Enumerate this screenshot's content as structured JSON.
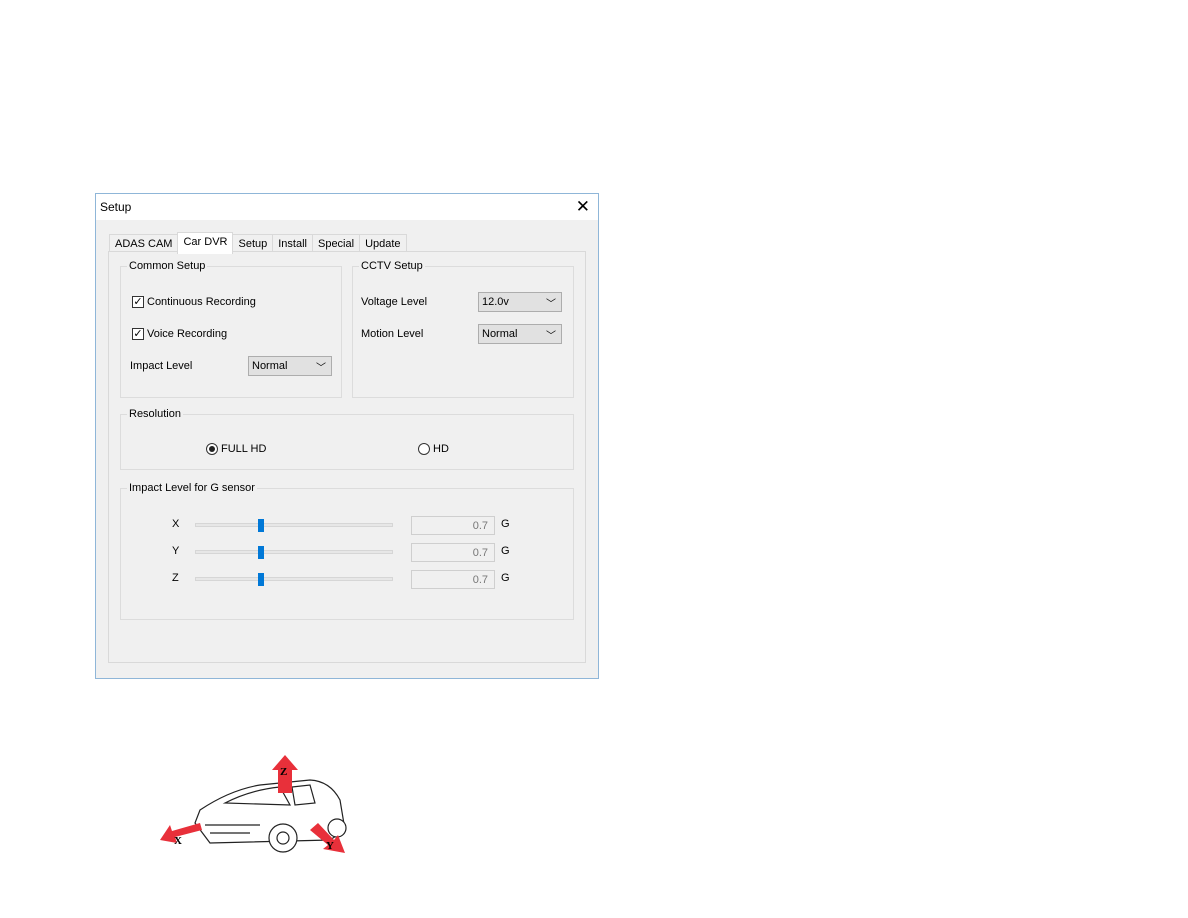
{
  "window": {
    "title": "Setup",
    "close_icon": "close-icon"
  },
  "tabs": [
    {
      "label": "ADAS CAM"
    },
    {
      "label": "Car DVR",
      "active": true
    },
    {
      "label": "Setup"
    },
    {
      "label": "Install"
    },
    {
      "label": "Special"
    },
    {
      "label": "Update"
    }
  ],
  "common": {
    "legend": "Common Setup",
    "continuous": {
      "label": "Continuous Recording",
      "checked": true
    },
    "voice": {
      "label": "Voice Recording",
      "checked": true
    },
    "impact_label": "Impact Level",
    "impact_value": "Normal"
  },
  "cctv": {
    "legend": "CCTV Setup",
    "voltage_label": "Voltage Level",
    "voltage_value": "12.0v",
    "motion_label": "Motion Level",
    "motion_value": "Normal"
  },
  "resolution": {
    "legend": "Resolution",
    "options": [
      {
        "label": "FULL HD",
        "selected": true
      },
      {
        "label": "HD",
        "selected": false
      }
    ]
  },
  "gsensor": {
    "legend": "Impact Level for G sensor",
    "unit": "G",
    "axes": [
      {
        "label": "X",
        "value": "0.7",
        "fraction": 0.33
      },
      {
        "label": "Y",
        "value": "0.7",
        "fraction": 0.33
      },
      {
        "label": "Z",
        "value": "0.7",
        "fraction": 0.33
      }
    ]
  },
  "illustration": {
    "labels": [
      "X",
      "Y",
      "Z"
    ],
    "arrow_color": "#e8303a"
  }
}
